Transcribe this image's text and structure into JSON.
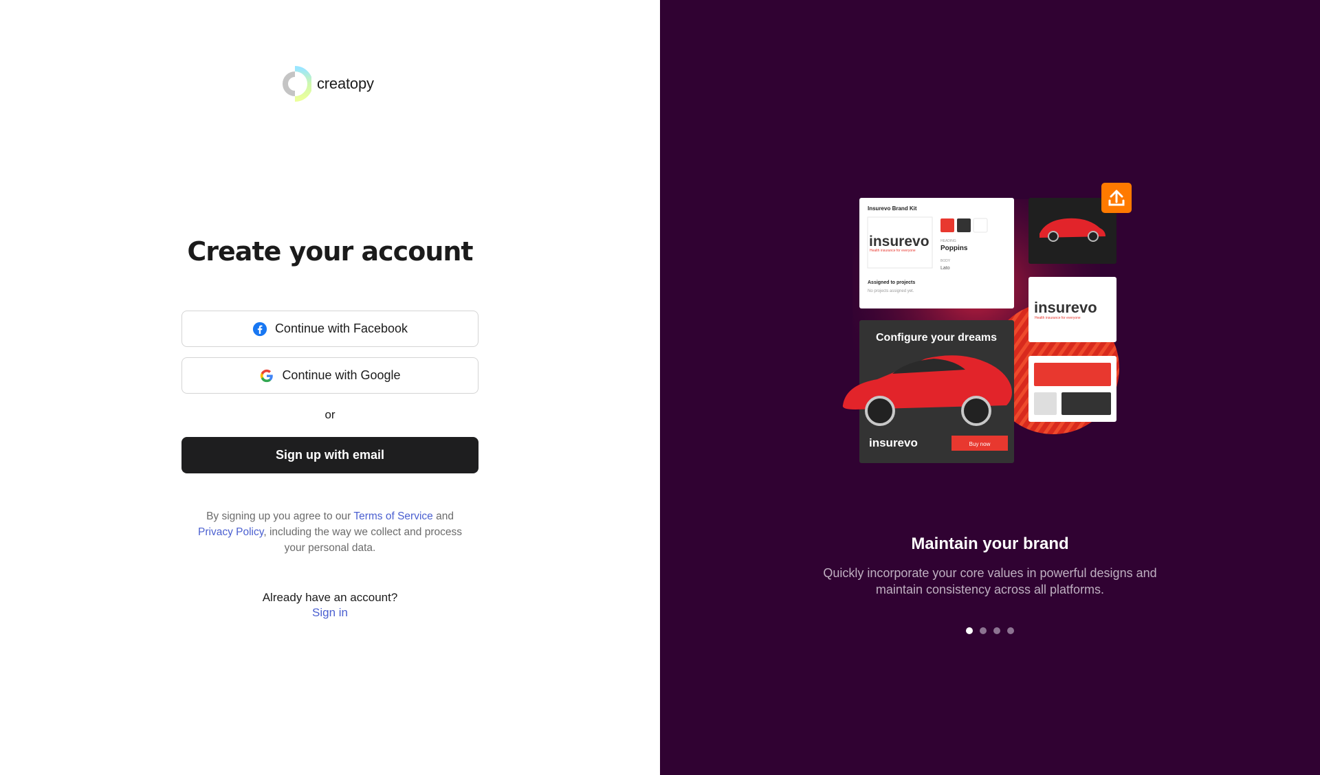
{
  "brand": {
    "name": "creatopy"
  },
  "signup": {
    "title": "Create your account",
    "facebook_label": "Continue with Facebook",
    "google_label": "Continue with Google",
    "or_label": "or",
    "email_label": "Sign up with email",
    "legal": {
      "prefix": "By signing up you agree to our ",
      "terms_link": "Terms of Service",
      "and": " and",
      "privacy_link": "Privacy Policy",
      "suffix": ", including the way we collect and process your personal data."
    },
    "already": "Already have an account?",
    "signin_link": "Sign in"
  },
  "illustration": {
    "brand_kit_title": "Insurevo Brand Kit",
    "brand_logo_text": "insurevo",
    "tagline": "Health insurance for everyone",
    "heading_label": "HEADING",
    "heading_font": "Poppins",
    "body_label": "BODY",
    "body_font": "Lato",
    "assigned_label": "Assigned to projects",
    "assigned_empty": "No projects assigned yet.",
    "ad_headline": "Configure your dreams",
    "buy_now": "Buy now"
  },
  "feature": {
    "title": "Maintain your brand",
    "description": "Quickly incorporate your core values in powerful designs and maintain consistency across all platforms.",
    "slides": 4,
    "active_slide": 1
  },
  "colors": {
    "primary_button": "#1e1e1f",
    "link": "#4a5fd0",
    "right_bg": "#300232",
    "accent_red": "#e8382f",
    "accent_orange": "#ff7a00"
  }
}
